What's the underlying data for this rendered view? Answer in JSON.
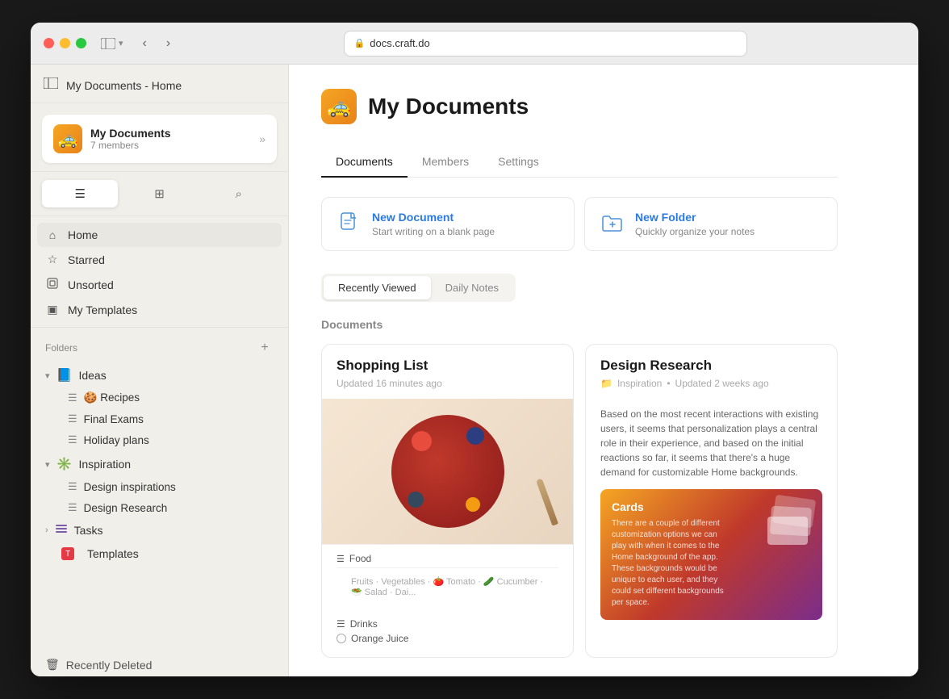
{
  "browser": {
    "url": "docs.craft.do",
    "title": "My Documents - Home"
  },
  "sidebar": {
    "title": "My Documents - Home",
    "workspace": {
      "name": "My Documents",
      "members": "7 members",
      "icon": "🚕"
    },
    "nav_items": [
      {
        "id": "home",
        "label": "Home",
        "icon": "⌂",
        "active": true
      },
      {
        "id": "starred",
        "label": "Starred",
        "icon": "☆",
        "active": false
      },
      {
        "id": "unsorted",
        "label": "Unsorted",
        "icon": "⊙",
        "active": false
      },
      {
        "id": "templates",
        "label": "My Templates",
        "icon": "▣",
        "active": false
      }
    ],
    "folders_label": "Folders",
    "folders": [
      {
        "id": "ideas",
        "label": "Ideas",
        "icon": "📘",
        "expanded": true,
        "children": [
          {
            "id": "recipes",
            "label": "Recipes",
            "emoji": "🍪"
          },
          {
            "id": "final-exams",
            "label": "Final Exams",
            "emoji": ""
          },
          {
            "id": "holiday-plans",
            "label": "Holiday plans",
            "emoji": ""
          }
        ]
      },
      {
        "id": "inspiration",
        "label": "Inspiration",
        "icon": "✳️",
        "expanded": true,
        "children": [
          {
            "id": "design-inspirations",
            "label": "Design inspirations",
            "emoji": ""
          },
          {
            "id": "design-research",
            "label": "Design Research",
            "emoji": ""
          }
        ]
      },
      {
        "id": "tasks",
        "label": "Tasks",
        "icon": "tasks",
        "expanded": false,
        "children": []
      }
    ],
    "special_items": [
      {
        "id": "templates-special",
        "label": "Templates",
        "type": "templates"
      },
      {
        "id": "recently-deleted",
        "label": "Recently Deleted",
        "icon": "🗑"
      }
    ]
  },
  "main": {
    "page_icon": "🚕",
    "page_title": "My Documents",
    "tabs": [
      {
        "id": "documents",
        "label": "Documents",
        "active": true
      },
      {
        "id": "members",
        "label": "Members",
        "active": false
      },
      {
        "id": "settings",
        "label": "Settings",
        "active": false
      }
    ],
    "action_cards": [
      {
        "id": "new-document",
        "title": "New Document",
        "description": "Start writing on a blank page",
        "icon": "📄"
      },
      {
        "id": "new-folder",
        "title": "New Folder",
        "description": "Quickly organize your notes",
        "icon": "📁"
      }
    ],
    "view_tabs": [
      {
        "id": "recently-viewed",
        "label": "Recently Viewed",
        "active": true
      },
      {
        "id": "daily-notes",
        "label": "Daily Notes",
        "active": false
      }
    ],
    "section_title": "Documents",
    "documents": [
      {
        "id": "shopping-list",
        "title": "Shopping List",
        "updated": "Updated 16 minutes ago",
        "has_image": true,
        "tags_label": "Food",
        "tags": "Fruits · Vegetables · 🍅 Tomato · 🥒 Cucumber · 🥗 Salad · Dai..."
      },
      {
        "id": "design-research",
        "title": "Design Research",
        "folder": "Inspiration",
        "updated": "Updated 2 weeks ago",
        "has_preview": true,
        "description": "Based on the most recent interactions with existing users, it seems that personalization plays a central role in their experience, and based on the initial reactions so far, it seems that there's a huge demand for customizable Home backgrounds.",
        "preview_title": "Cards",
        "preview_text": "There are a couple of different customization options we can play with when it comes to the Home background of the app. These backgrounds would be unique to each user, and they could set different backgrounds per space."
      }
    ],
    "drinks_label": "Drinks",
    "oj_label": "Orange Juice"
  }
}
